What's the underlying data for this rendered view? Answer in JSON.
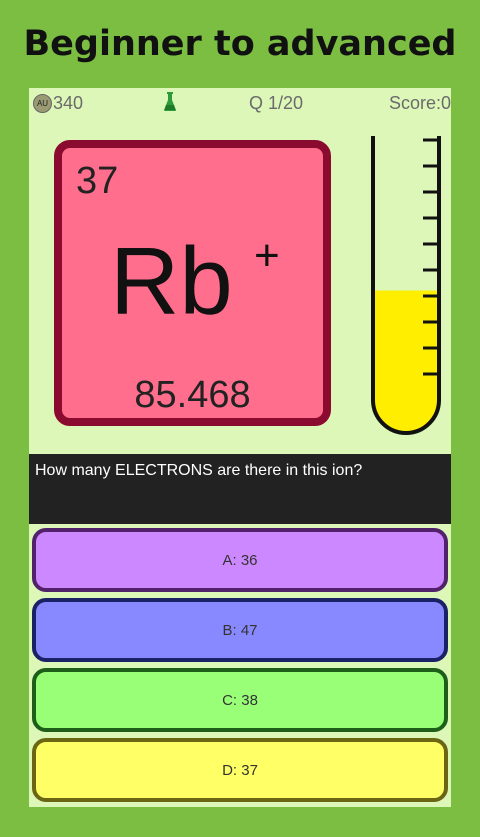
{
  "banner": {
    "title": "Beginner to advanced"
  },
  "status": {
    "coin_label": "AU",
    "coins": "340",
    "question_counter": "Q 1/20",
    "score": "Score:0"
  },
  "element": {
    "atomic_number": "37",
    "symbol": "Rb",
    "charge": "+",
    "atomic_mass": "85.468"
  },
  "progress": {
    "fill_fraction": 0.48,
    "fill_color": "#ffee00"
  },
  "question": {
    "text": "How many ELECTRONS are there in this ion?"
  },
  "answers": [
    {
      "label": "A: 36",
      "color": "#cc88ff"
    },
    {
      "label": "B: 47",
      "color": "#8888ff"
    },
    {
      "label": "C: 38",
      "color": "#99ff77"
    },
    {
      "label": "D: 37",
      "color": "#ffff66"
    }
  ],
  "colors": {
    "background": "#7cbe42",
    "screen": "#dcf7b8",
    "tile_fill": "#ff6f8d",
    "tile_border": "#8b0a30",
    "flask_icon": "#2e9a3a"
  }
}
